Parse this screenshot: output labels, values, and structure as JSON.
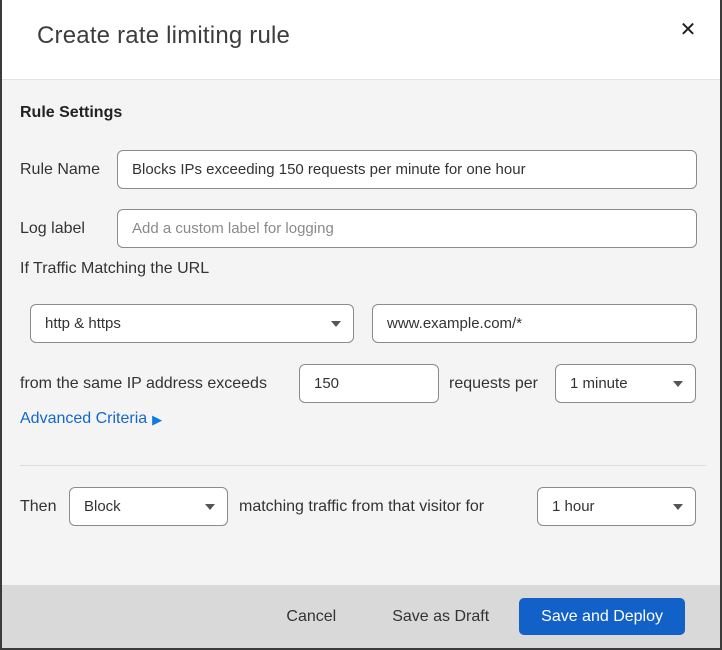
{
  "colors": {
    "primary_button": "#1261c9",
    "link": "#1567c9",
    "body_background": "#f4f4f4",
    "footer_background": "#d9d9d9",
    "outer_border": "#3b3b3b"
  },
  "header": {
    "title": "Create rate limiting rule",
    "close_glyph": "✕"
  },
  "body": {
    "section_heading": "Rule Settings",
    "rule_name": {
      "label": "Rule Name",
      "value": "Blocks IPs exceeding 150 requests per minute for one hour"
    },
    "log_label": {
      "label": "Log label",
      "placeholder": "Add a custom label for logging"
    },
    "traffic_match": {
      "intro": "If Traffic Matching the URL",
      "scheme_selected": "http & https",
      "url_value": "www.example.com/*"
    },
    "threshold": {
      "prefix": "from the same IP address exceeds",
      "count_value": "150",
      "middle": "requests per",
      "period_selected": "1 minute"
    },
    "advanced_criteria": {
      "label": "Advanced Criteria",
      "arrow_glyph": "▶"
    },
    "then": {
      "label": "Then",
      "action_selected": "Block",
      "middle": "matching traffic from that visitor for",
      "duration_selected": "1 hour"
    }
  },
  "footer": {
    "cancel": "Cancel",
    "save_draft": "Save as Draft",
    "save_deploy": "Save and Deploy"
  }
}
